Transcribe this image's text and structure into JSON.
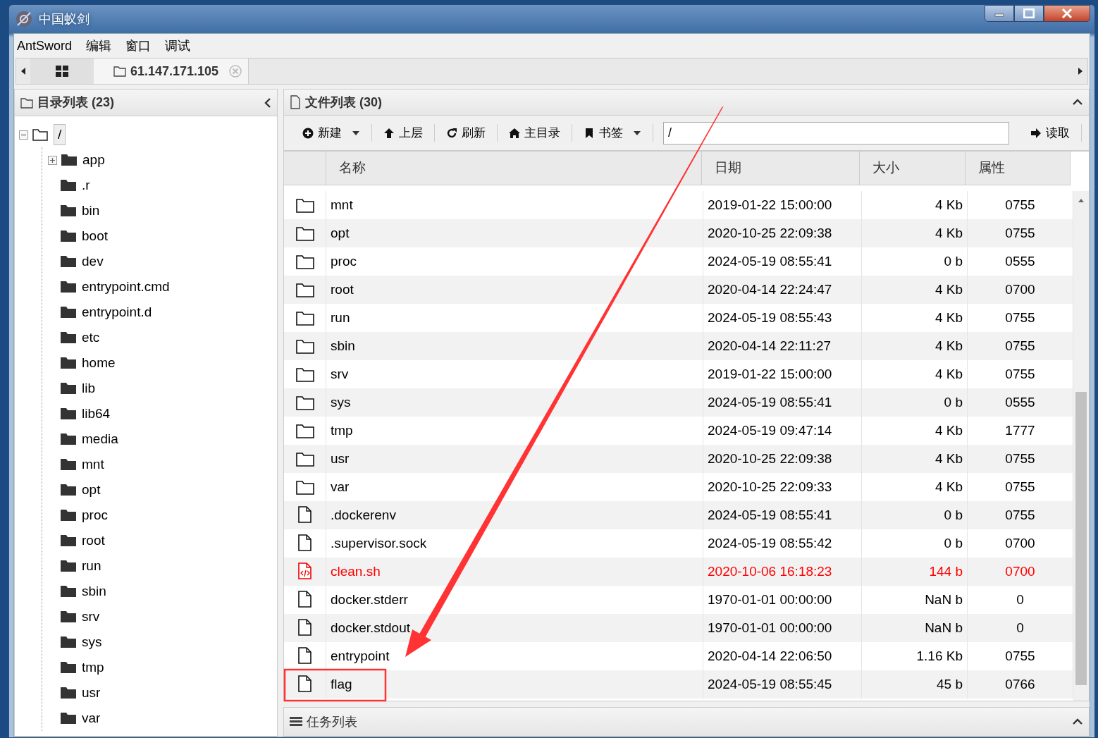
{
  "window": {
    "title": "中国蚁剑"
  },
  "menu": [
    "AntSword",
    "编辑",
    "窗口",
    "调试"
  ],
  "tabs": [
    {
      "kind": "home",
      "selected": false
    },
    {
      "kind": "connection",
      "label": "61.147.171.105",
      "selected": true
    }
  ],
  "dir_panel": {
    "title": "目录列表 (23)",
    "tree": [
      {
        "label": "/",
        "expanded": true,
        "children": [
          {
            "label": "app",
            "expandable": true
          },
          {
            "label": ".r",
            "expandable": false
          },
          {
            "label": "bin",
            "expandable": false
          },
          {
            "label": "boot",
            "expandable": false
          },
          {
            "label": "dev",
            "expandable": false
          },
          {
            "label": "entrypoint.cmd",
            "expandable": false
          },
          {
            "label": "entrypoint.d",
            "expandable": false
          },
          {
            "label": "etc",
            "expandable": false
          },
          {
            "label": "home",
            "expandable": false
          },
          {
            "label": "lib",
            "expandable": false
          },
          {
            "label": "lib64",
            "expandable": false
          },
          {
            "label": "media",
            "expandable": false
          },
          {
            "label": "mnt",
            "expandable": false
          },
          {
            "label": "opt",
            "expandable": false
          },
          {
            "label": "proc",
            "expandable": false
          },
          {
            "label": "root",
            "expandable": false
          },
          {
            "label": "run",
            "expandable": false
          },
          {
            "label": "sbin",
            "expandable": false
          },
          {
            "label": "srv",
            "expandable": false
          },
          {
            "label": "sys",
            "expandable": false
          },
          {
            "label": "tmp",
            "expandable": false
          },
          {
            "label": "usr",
            "expandable": false
          },
          {
            "label": "var",
            "expandable": false
          }
        ]
      }
    ]
  },
  "file_panel": {
    "title": "文件列表 (30)",
    "toolbar": [
      {
        "kind": "new",
        "label": "新建",
        "dropdown": true
      },
      {
        "kind": "up",
        "label": "上层",
        "dropdown": false
      },
      {
        "kind": "refresh",
        "label": "刷新",
        "dropdown": false
      },
      {
        "kind": "home",
        "label": "主目录",
        "dropdown": false
      },
      {
        "kind": "bookmark",
        "label": "书签",
        "dropdown": true
      }
    ],
    "path": "/",
    "read_button": "读取",
    "columns": [
      "名称",
      "日期",
      "大小",
      "属性"
    ],
    "rows": [
      {
        "kind": "folder",
        "name": "mnt",
        "date": "2019-01-22 15:00:00",
        "size": "4 Kb",
        "attr": "0755"
      },
      {
        "kind": "folder",
        "name": "opt",
        "date": "2020-10-25 22:09:38",
        "size": "4 Kb",
        "attr": "0755"
      },
      {
        "kind": "folder",
        "name": "proc",
        "date": "2024-05-19 08:55:41",
        "size": "0 b",
        "attr": "0555"
      },
      {
        "kind": "folder",
        "name": "root",
        "date": "2020-04-14 22:24:47",
        "size": "4 Kb",
        "attr": "0700"
      },
      {
        "kind": "folder",
        "name": "run",
        "date": "2024-05-19 08:55:43",
        "size": "4 Kb",
        "attr": "0755"
      },
      {
        "kind": "folder",
        "name": "sbin",
        "date": "2020-04-14 22:11:27",
        "size": "4 Kb",
        "attr": "0755"
      },
      {
        "kind": "folder",
        "name": "srv",
        "date": "2019-01-22 15:00:00",
        "size": "4 Kb",
        "attr": "0755"
      },
      {
        "kind": "folder",
        "name": "sys",
        "date": "2024-05-19 08:55:41",
        "size": "0 b",
        "attr": "0555"
      },
      {
        "kind": "folder",
        "name": "tmp",
        "date": "2024-05-19 09:47:14",
        "size": "4 Kb",
        "attr": "1777"
      },
      {
        "kind": "folder",
        "name": "usr",
        "date": "2020-10-25 22:09:38",
        "size": "4 Kb",
        "attr": "0755"
      },
      {
        "kind": "folder",
        "name": "var",
        "date": "2020-10-25 22:09:33",
        "size": "4 Kb",
        "attr": "0755"
      },
      {
        "kind": "file",
        "name": ".dockerenv",
        "date": "2024-05-19 08:55:41",
        "size": "0 b",
        "attr": "0755"
      },
      {
        "kind": "file",
        "name": ".supervisor.sock",
        "date": "2024-05-19 08:55:42",
        "size": "0 b",
        "attr": "0700"
      },
      {
        "kind": "script",
        "name": "clean.sh",
        "date": "2020-10-06 16:18:23",
        "size": "144 b",
        "attr": "0700"
      },
      {
        "kind": "file",
        "name": "docker.stderr",
        "date": "1970-01-01 00:00:00",
        "size": "NaN b",
        "attr": "0"
      },
      {
        "kind": "file",
        "name": "docker.stdout",
        "date": "1970-01-01 00:00:00",
        "size": "NaN b",
        "attr": "0"
      },
      {
        "kind": "file",
        "name": "entrypoint",
        "date": "2020-04-14 22:06:50",
        "size": "1.16 Kb",
        "attr": "0755"
      },
      {
        "kind": "file",
        "name": "flag",
        "date": "2024-05-19 08:55:45",
        "size": "45 b",
        "attr": "0766"
      }
    ]
  },
  "task_panel": {
    "title": "任务列表"
  }
}
